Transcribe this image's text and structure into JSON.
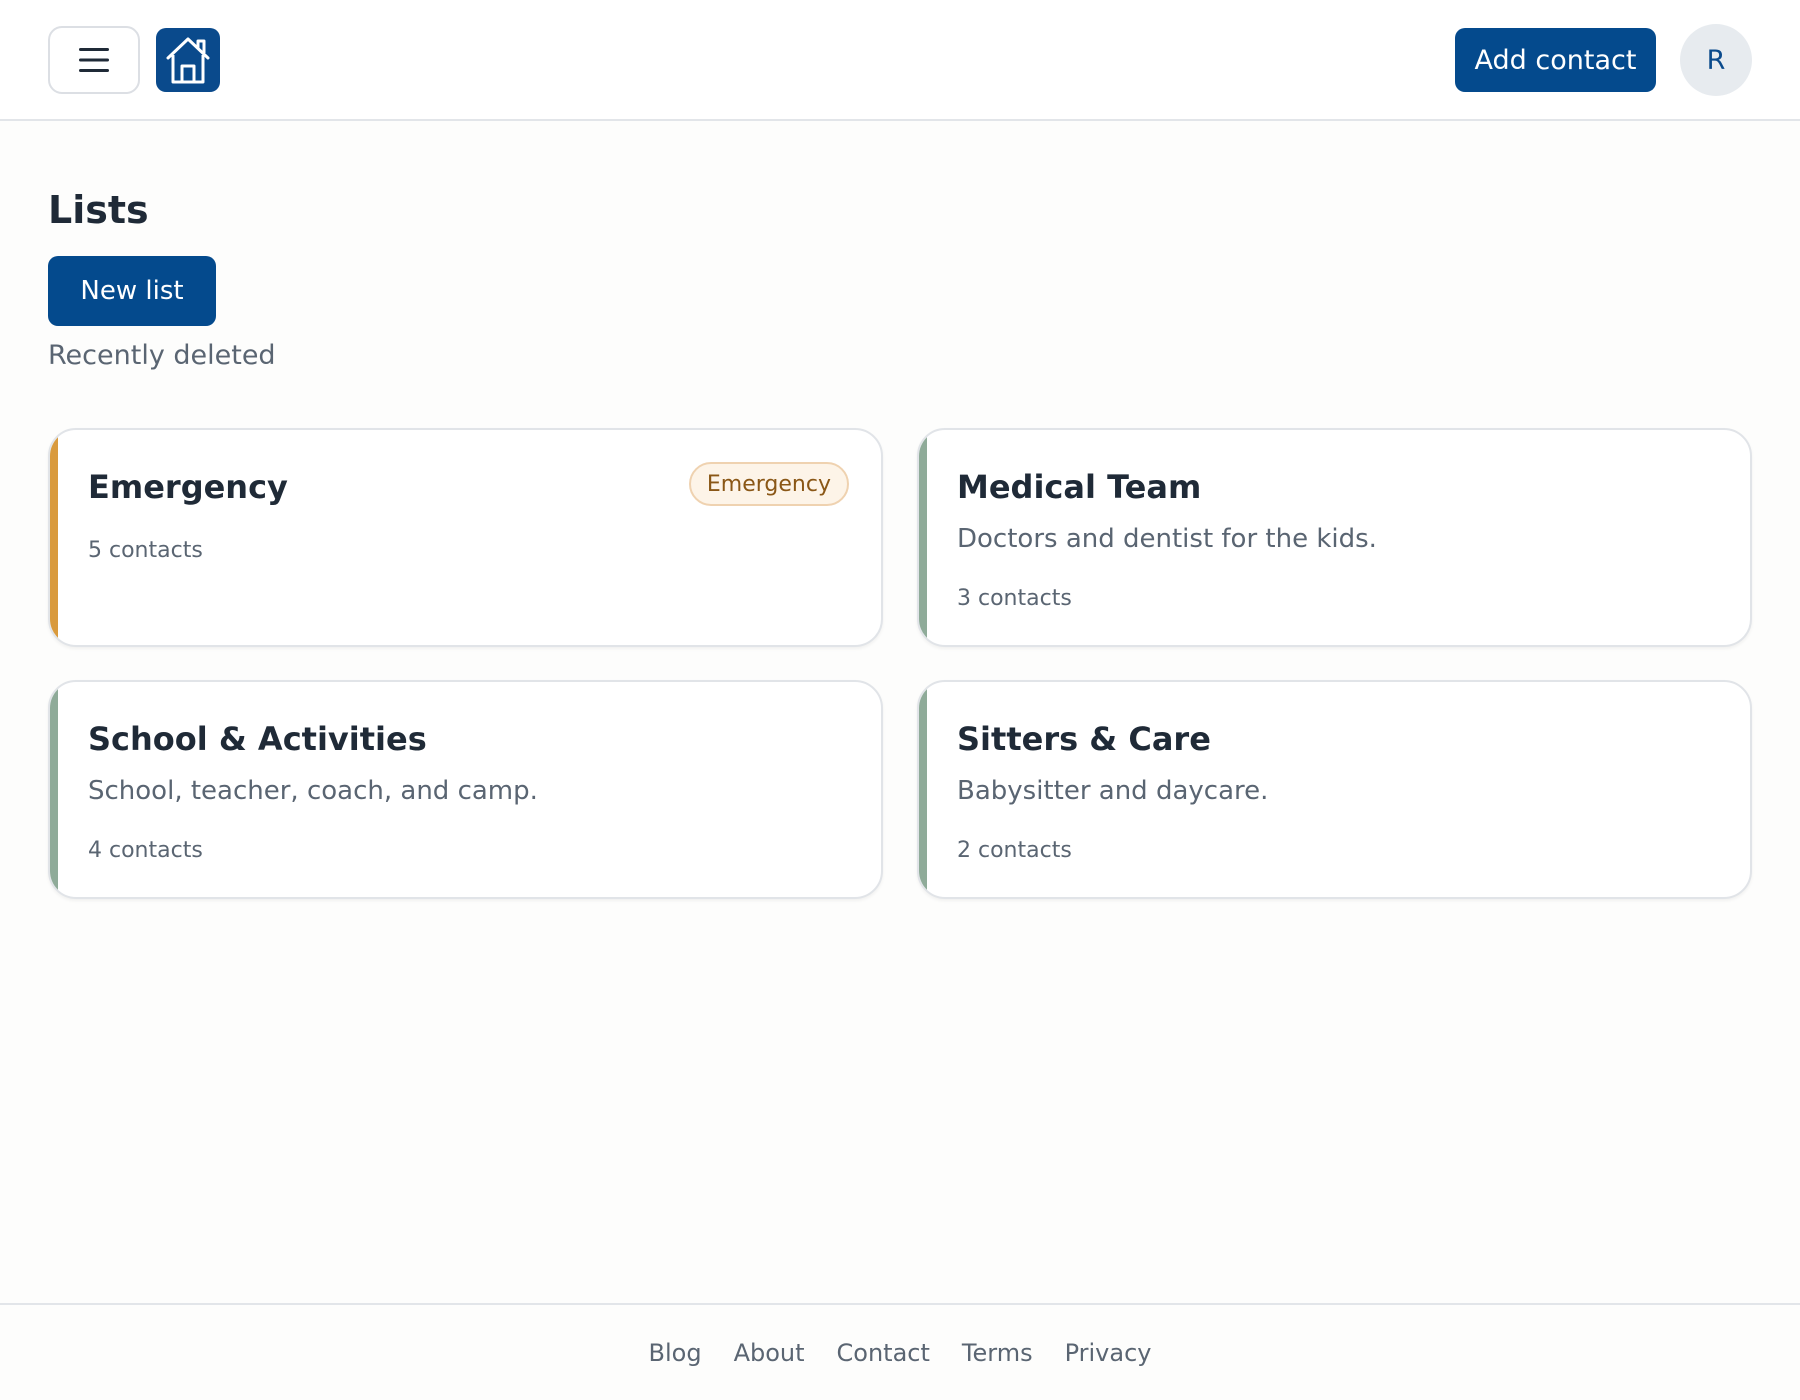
{
  "header": {
    "menu_icon": "hamburger-menu-icon",
    "logo_icon": "house-icon",
    "add_contact_label": "Add contact",
    "avatar_initial": "R"
  },
  "main": {
    "title": "Lists",
    "new_list_label": "New list",
    "recently_deleted_label": "Recently deleted"
  },
  "lists": [
    {
      "title": "Emergency",
      "badge": "Emergency",
      "description": "",
      "count": "5 contacts",
      "accent": "#d99a3d"
    },
    {
      "title": "Medical Team",
      "description": "Doctors and dentist for the kids.",
      "count": "3 contacts",
      "accent": "#8fab99"
    },
    {
      "title": "School & Activities",
      "description": "School, teacher, coach, and camp.",
      "count": "4 contacts",
      "accent": "#8fab99"
    },
    {
      "title": "Sitters & Care",
      "description": "Babysitter and daycare.",
      "count": "2 contacts",
      "accent": "#8fab99"
    }
  ],
  "footer": {
    "links": [
      "Blog",
      "About",
      "Contact",
      "Terms",
      "Privacy"
    ]
  },
  "colors": {
    "primary": "#044a8d",
    "emergency_accent": "#d99a3d",
    "default_accent": "#8fab99"
  }
}
